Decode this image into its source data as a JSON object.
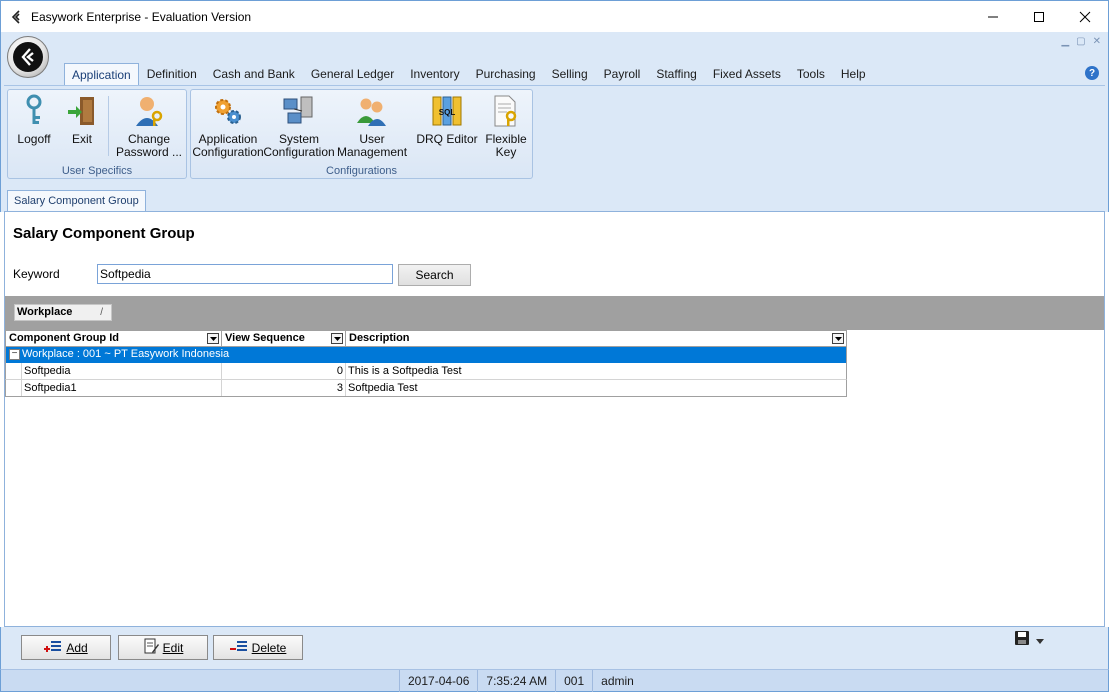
{
  "window": {
    "title": "Easywork Enterprise - Evaluation Version",
    "minimize": "—",
    "maximize": "☐",
    "close": "✕"
  },
  "ribbon": {
    "tabs": [
      "Application",
      "Definition",
      "Cash and Bank",
      "General Ledger",
      "Inventory",
      "Purchasing",
      "Selling",
      "Payroll",
      "Staffing",
      "Fixed Assets",
      "Tools",
      "Help"
    ],
    "active_tab": "Application",
    "groups": {
      "user_specifics": {
        "label": "User Specifics",
        "logoff": "Logoff",
        "exit": "Exit",
        "change_password_l1": "Change",
        "change_password_l2": "Password ..."
      },
      "configurations": {
        "label": "Configurations",
        "app_config_l1": "Application",
        "app_config_l2": "Configuration",
        "sys_config_l1": "System",
        "sys_config_l2": "Configuration",
        "user_mgmt_l1": "User",
        "user_mgmt_l2": "Management",
        "drq_editor": "DRQ Editor",
        "flexible_key_l1": "Flexible",
        "flexible_key_l2": "Key"
      }
    }
  },
  "document_tab": "Salary Component Group",
  "page": {
    "title": "Salary Component Group",
    "keyword_label": "Keyword",
    "keyword_value": "Softpedia",
    "search_button": "Search"
  },
  "grid": {
    "group_by_chip": "Workplace",
    "group_by_slash": "/",
    "columns": [
      "Component Group Id",
      "View Sequence",
      "Description"
    ],
    "group_row": "Workplace : 001 ~ PT Easywork Indonesia",
    "rows": [
      {
        "id": "Softpedia",
        "seq": "0",
        "desc": "This is a Softpedia Test"
      },
      {
        "id": "Softpedia1",
        "seq": "3",
        "desc": "Softpedia Test"
      }
    ]
  },
  "actions": {
    "add": "Add",
    "edit": "Edit",
    "delete": "Delete"
  },
  "status": {
    "date": "2017-04-06",
    "time": "7:35:24 AM",
    "code": "001",
    "user": "admin"
  },
  "colors": {
    "accent": "#0078d7",
    "ribbon_bg": "#dbe8f7",
    "border": "#6d9fd6"
  }
}
